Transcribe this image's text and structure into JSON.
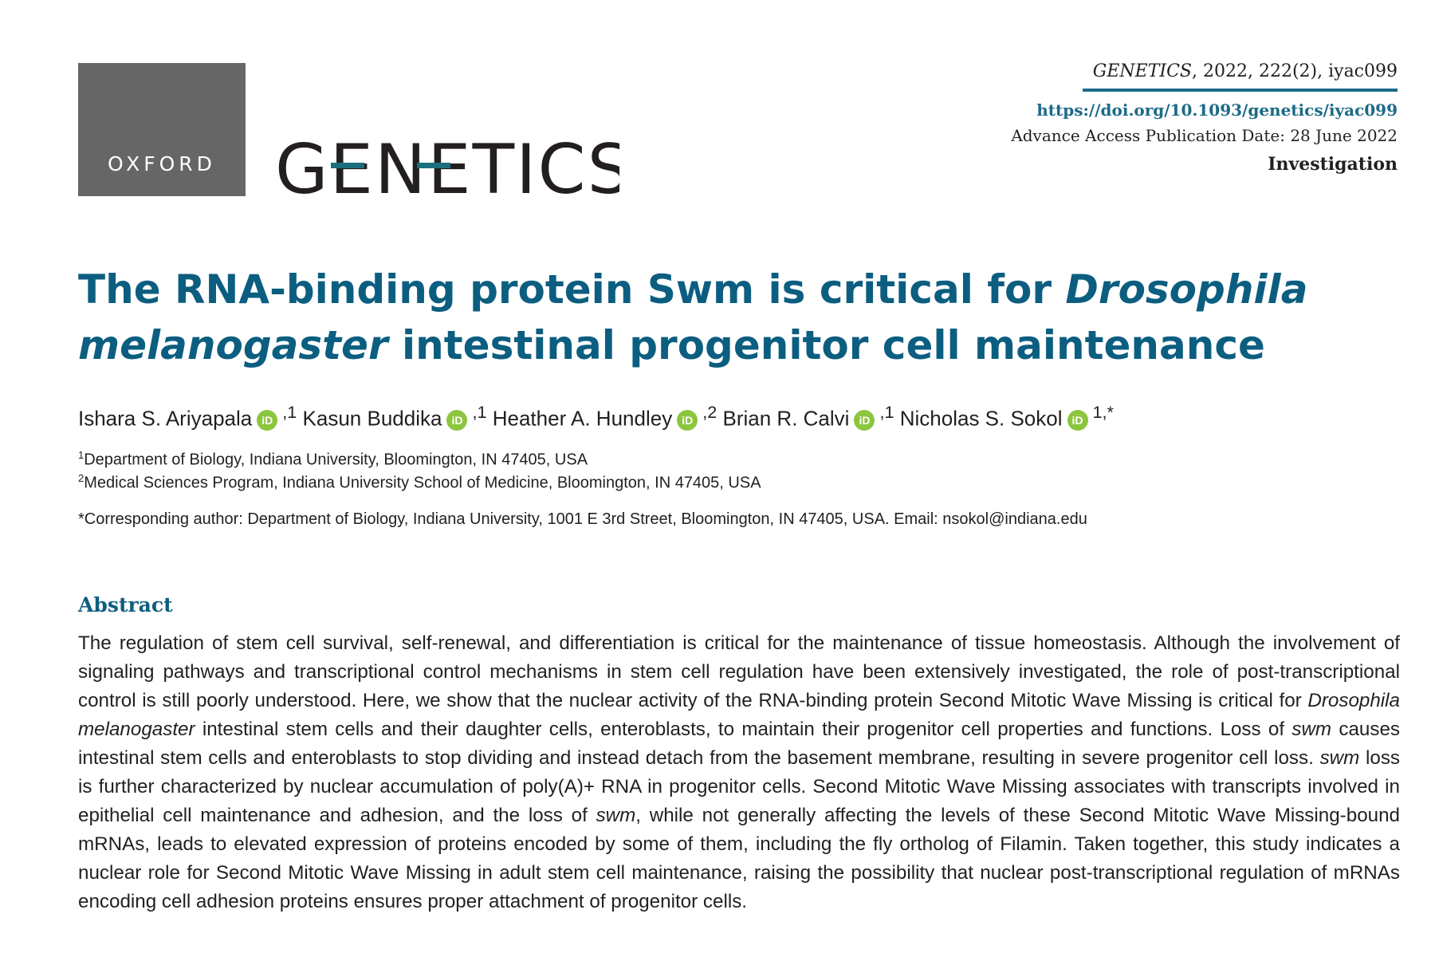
{
  "header": {
    "publisher_logo": "OXFORD",
    "journal_logo": "GENETICS",
    "journal_name": "GENETICS",
    "citation_rest": ", 2022, 222(2), iyac099",
    "doi": "https://doi.org/10.1093/genetics/iyac099",
    "advance_access": "Advance Access Publication Date: 28 June 2022",
    "article_type": "Investigation",
    "accent_color": "#1c6a87"
  },
  "title": {
    "part1": "The RNA-binding protein Swm is critical for ",
    "italic1": "Drosophila",
    "italic2": "melanogaster",
    "part2": " intestinal progenitor cell maintenance"
  },
  "authors": [
    {
      "name": "Ishara S. Ariyapala",
      "aff": ",1"
    },
    {
      "name": "Kasun Buddika",
      "aff": ",1"
    },
    {
      "name": "Heather A. Hundley",
      "aff": ",2"
    },
    {
      "name": "Brian R. Calvi",
      "aff": ",1"
    },
    {
      "name": "Nicholas S. Sokol",
      "aff": "1,*"
    }
  ],
  "orcid_label": "iD",
  "affiliations": [
    {
      "num": "1",
      "text": "Department of Biology, Indiana University, Bloomington, IN 47405, USA"
    },
    {
      "num": "2",
      "text": "Medical Sciences Program, Indiana University School of Medicine, Bloomington, IN 47405, USA"
    }
  ],
  "corresponding": "*Corresponding author: Department of Biology, Indiana University, 1001 E 3rd Street, Bloomington, IN 47405, USA. Email: nsokol@indiana.edu",
  "abstract": {
    "heading": "Abstract",
    "s1": "The regulation of stem cell survival, self-renewal, and differentiation is critical for the maintenance of tissue homeostasis. Although the involvement of signaling pathways and transcriptional control mechanisms in stem cell regulation have been extensively investigated, the role of post-transcriptional control is still poorly understood. Here, we show that the nuclear activity of the RNA-binding protein Second Mitotic Wave Missing is critical for ",
    "i1": "Drosophila melanogaster",
    "s2": " intestinal stem cells and their daughter cells, enteroblasts, to maintain their progenitor cell properties and functions. Loss of ",
    "i2": "swm",
    "s3": " causes intestinal stem cells and enteroblasts to stop dividing and instead detach from the basement membrane, resulting in severe progenitor cell loss. ",
    "i3": "swm",
    "s4": " loss is further characterized by nuclear accumulation of poly(A)+ RNA in progenitor cells. Second Mitotic Wave Missing associates with transcripts involved in epithelial cell maintenance and adhesion, and the loss of ",
    "i4": "swm",
    "s5": ", while not generally affecting the levels of these Second Mitotic Wave Missing-bound mRNAs, leads to elevated expression of proteins encoded by some of them, including the fly ortholog of Filamin. Taken together, this study indicates a nuclear role for Second Mitotic Wave Missing in adult stem cell maintenance, raising the possibility that nuclear post-transcriptional regulation of mRNAs encoding cell adhesion proteins ensures proper attachment of progenitor cells."
  }
}
